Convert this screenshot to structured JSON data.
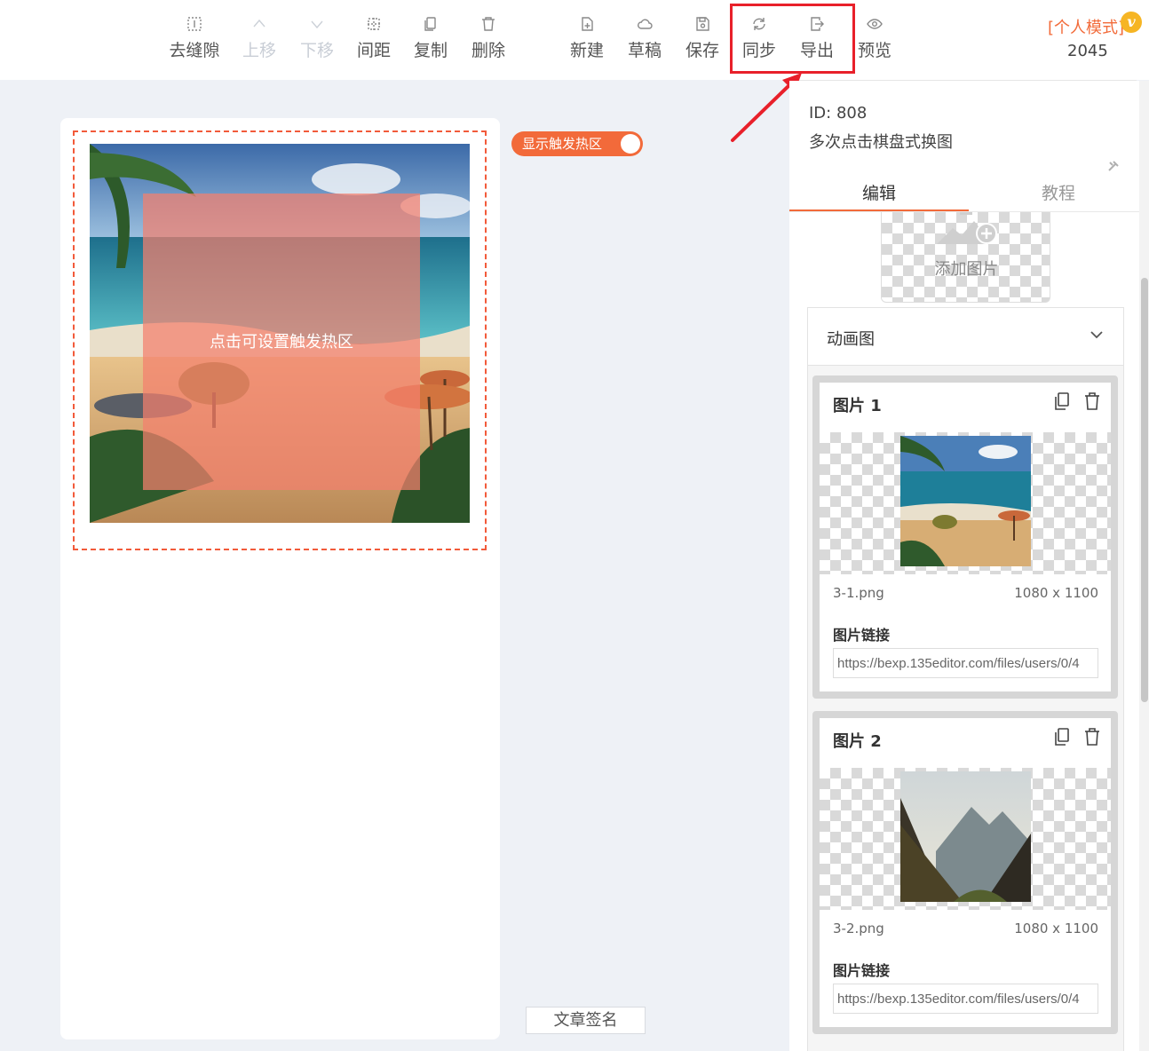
{
  "toolbar": {
    "remove_gap": "去缝隙",
    "move_up": "上移",
    "move_down": "下移",
    "spacing": "间距",
    "copy": "复制",
    "delete": "删除",
    "new": "新建",
    "draft": "草稿",
    "save": "保存",
    "sync": "同步",
    "export": "导出",
    "preview": "预览",
    "mode": "[个人模式]",
    "vip_badge": "v",
    "count": "2045"
  },
  "canvas": {
    "hotzone_hint": "点击可设置触发热区",
    "toggle_label": "显示触发热区",
    "signature_button": "文章签名"
  },
  "panel": {
    "id": "ID: 808",
    "name": "多次点击棋盘式换图",
    "tabs": [
      "编辑",
      "教程"
    ],
    "add_image": "添加图片",
    "section_title": "动画图",
    "items": [
      {
        "title": "图片 1",
        "file": "3-1.png",
        "size": "1080 x 1100",
        "link_label": "图片链接",
        "link": "https://bexp.135editor.com/files/users/0/4"
      },
      {
        "title": "图片 2",
        "file": "3-2.png",
        "size": "1080 x 1100",
        "link_label": "图片链接",
        "link": "https://bexp.135editor.com/files/users/0/4"
      }
    ]
  },
  "colors": {
    "accent": "#f26a3a",
    "highlight": "#e8202a"
  }
}
